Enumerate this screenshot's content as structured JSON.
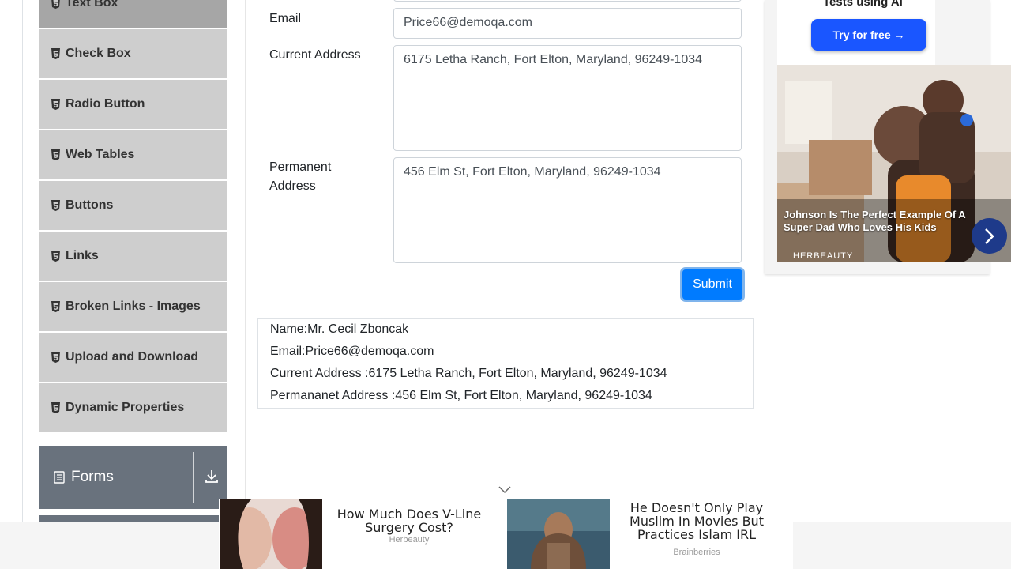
{
  "sidebar": {
    "items": [
      {
        "label": "Text Box"
      },
      {
        "label": "Check Box"
      },
      {
        "label": "Radio Button"
      },
      {
        "label": "Web Tables"
      },
      {
        "label": "Buttons"
      },
      {
        "label": "Links"
      },
      {
        "label": "Broken Links - Images"
      },
      {
        "label": "Upload and Download"
      },
      {
        "label": "Dynamic Properties"
      }
    ],
    "group_forms": "Forms"
  },
  "form": {
    "email_label": "Email",
    "email_value": "Price66@demoqa.com",
    "current_address_label": "Current Address",
    "current_address_value": "6175 Letha Ranch, Fort Elton, Maryland, 96249-1034",
    "permanent_address_label_1": "Permanent",
    "permanent_address_label_2": "Address",
    "permanent_address_value": "456 Elm St, Fort Elton, Maryland, 96249-1034",
    "submit_label": "Submit"
  },
  "output": {
    "name": "Name:Mr. Cecil Zboncak",
    "email": "Email:Price66@demoqa.com",
    "current_address": "Current Address :6175 Letha Ranch, Fort Elton, Maryland, 96249-1034",
    "permanent_address": "Permananet Address :456 Elm St, Fort Elton, Maryland, 96249-1034"
  },
  "ad_right": {
    "top_text": "Tests using AI",
    "button_label": "Try for free →",
    "caption": "Johnson Is The Perfect Example Of A Super Dad Who Loves His Kids",
    "brand": "HERBEAUTY"
  },
  "ad_bottom": [
    {
      "title": "How Much Does V-Line Surgery Cost?",
      "source": "Herbeauty"
    },
    {
      "title": "He Doesn't Only Play Muslim In Movies But Practices Islam IRL",
      "source": "Brainberries"
    }
  ],
  "colors": {
    "primary": "#007bff",
    "menu_bg": "#cecece",
    "menu_active": "#a6a6a6",
    "group_header": "#69727d"
  }
}
